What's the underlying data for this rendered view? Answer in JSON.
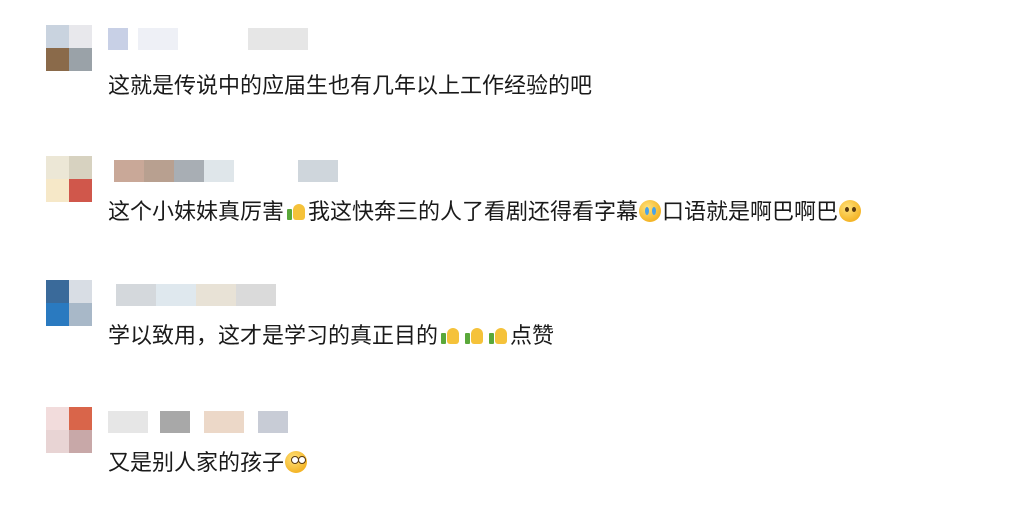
{
  "comments": [
    {
      "text": "这就是传说中的应届生也有几年以上工作经验的吧",
      "avatar_colors": [
        "#c9d3df",
        "#e8e8ec",
        "#8a6a4a",
        "#9aa2a8"
      ],
      "name_colors": [
        "#c8d0e6",
        "#eef0f6",
        "#e6e6e6"
      ],
      "segments": [
        {
          "type": "text",
          "value": "这就是传说中的应届生也有几年以上工作经验的吧"
        }
      ]
    },
    {
      "text": "这个小妹妹真厉害 我这快奔三的人了看剧还得看字幕 口语就是啊巴啊巴",
      "avatar_colors": [
        "#ece7d6",
        "#d7d2c0",
        "#f6e8c8",
        "#d0574b"
      ],
      "name_colors": [
        "#c9a898",
        "#b8a090",
        "#a8aeb4",
        "#dfe6ea",
        "#cfd6dc"
      ],
      "segments": [
        {
          "type": "text",
          "value": "这个小妹妹真厉害"
        },
        {
          "type": "emoji",
          "icon": "thumbs-up-icon",
          "cls": "thumb"
        },
        {
          "type": "text",
          "value": "我这快奔三的人了看剧还得看字幕"
        },
        {
          "type": "emoji",
          "icon": "crying-face-icon",
          "cls": "face cry"
        },
        {
          "type": "text",
          "value": "口语就是啊巴啊巴"
        },
        {
          "type": "emoji",
          "icon": "sobbing-face-icon",
          "cls": "face sob"
        }
      ]
    },
    {
      "text": "学以致用，这才是学习的真正目的 点赞",
      "avatar_colors": [
        "#3a6a9a",
        "#d8dde4",
        "#2a7ac0",
        "#a8b8c8"
      ],
      "name_colors": [
        "#d4d8dc",
        "#dfe8ee",
        "#e8e2d6",
        "#dadada"
      ],
      "segments": [
        {
          "type": "text",
          "value": "学以致用，这才是学习的真正目的"
        },
        {
          "type": "emoji",
          "icon": "thumbs-up-icon",
          "cls": "thumb"
        },
        {
          "type": "emoji",
          "icon": "thumbs-up-icon",
          "cls": "thumb"
        },
        {
          "type": "emoji",
          "icon": "thumbs-up-icon",
          "cls": "thumb"
        },
        {
          "type": "text",
          "value": "点赞"
        }
      ]
    },
    {
      "text": "又是别人家的孩子",
      "avatar_colors": [
        "#f2dcdc",
        "#d9654a",
        "#e8d4d4",
        "#c8a8a8"
      ],
      "name_colors": [
        "#e6e6e6",
        "#a8a8a8",
        "#ecd8c8",
        "#c8ccd6"
      ],
      "segments": [
        {
          "type": "text",
          "value": "又是别人家的孩子"
        },
        {
          "type": "emoji",
          "icon": "flushed-face-icon",
          "cls": "face shock"
        }
      ]
    }
  ]
}
